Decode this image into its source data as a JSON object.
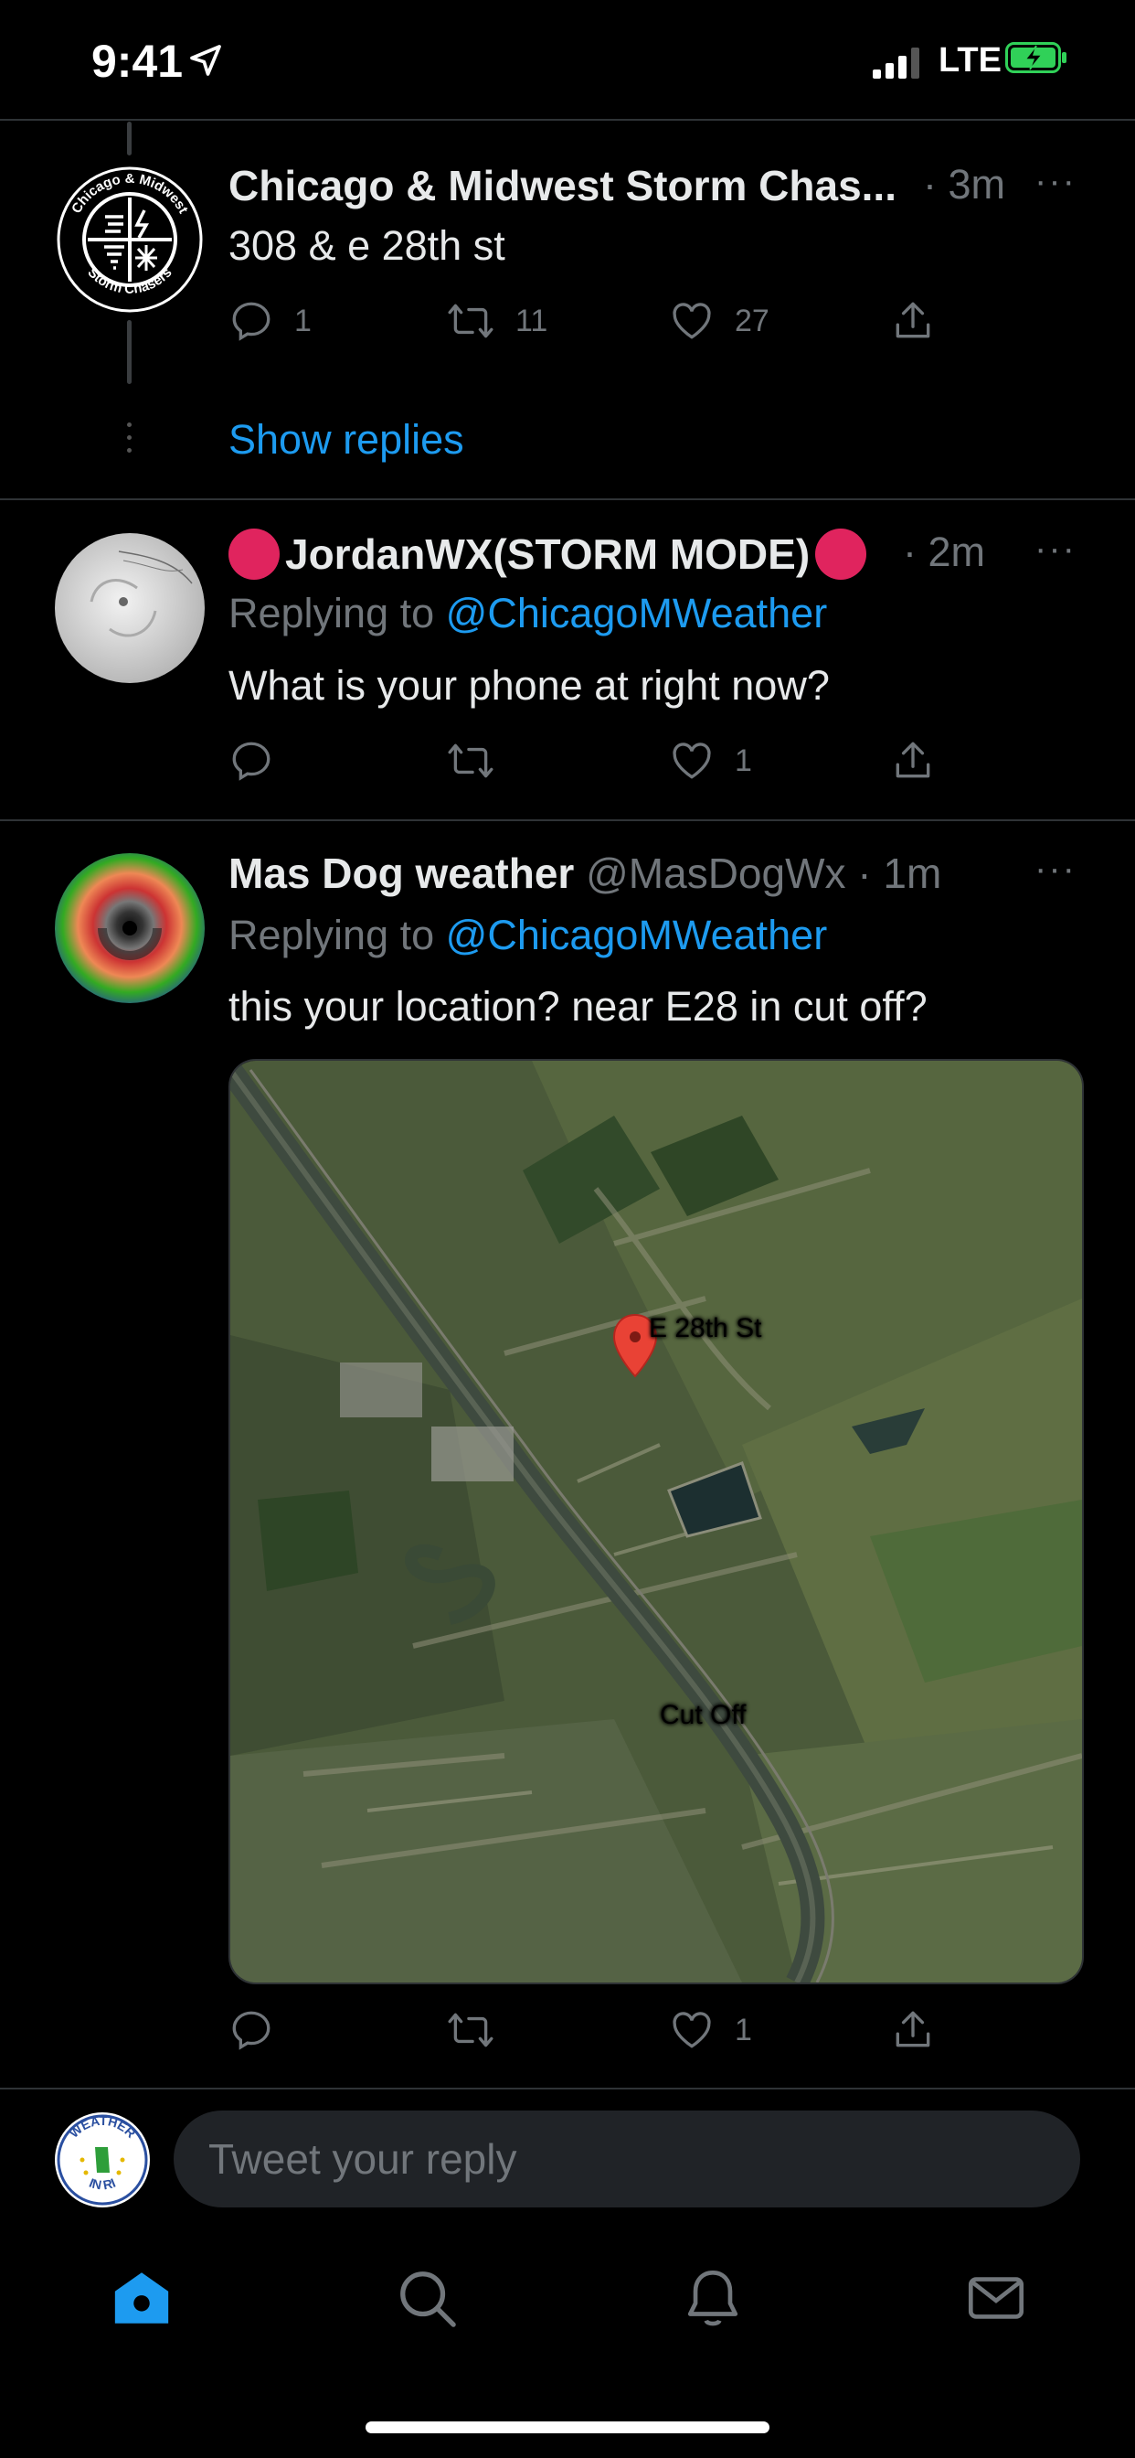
{
  "status": {
    "time": "9:41",
    "network": "LTE"
  },
  "tweets": [
    {
      "display_name": "Chicago & Midwest Storm Chas...",
      "time": "3m",
      "text": "308 & e 28th st",
      "avatar": {
        "ring_top": "Chicago & Midwest",
        "ring_bottom": "Storm Chasers"
      },
      "actions": {
        "replies": "1",
        "retweets": "11",
        "likes": "27"
      }
    },
    {
      "display_name": "JordanWX(STORM MODE)",
      "time": "2m",
      "replying_prefix": "Replying to",
      "replying_handle": "@ChicagoMWeather",
      "text": "What is your phone at right now?",
      "actions": {
        "replies": "",
        "retweets": "",
        "likes": "1"
      }
    },
    {
      "display_name": "Mas Dog weather",
      "handle": "@MasDogWx",
      "time": "1m",
      "replying_prefix": "Replying to",
      "replying_handle": "@ChicagoMWeather",
      "text": "this your location? near E28 in cut off?",
      "map_labels": {
        "pin": "E 28th St",
        "town": "Cut Off"
      },
      "actions": {
        "replies": "",
        "retweets": "",
        "likes": "1"
      }
    }
  ],
  "show_replies": "Show replies",
  "composer": {
    "placeholder": "Tweet your reply",
    "avatar_text_top": "WEATHER",
    "avatar_text_bottom": "IN RI"
  },
  "tab_bar": {
    "items": [
      "home-icon",
      "search-icon",
      "notifications-icon",
      "messages-icon"
    ],
    "active": "home-icon"
  },
  "colors": {
    "accent": "#1d9bf0",
    "background": "#000000",
    "muted": "#71767b",
    "live_dot": "#e0245e",
    "battery": "#30d158"
  }
}
